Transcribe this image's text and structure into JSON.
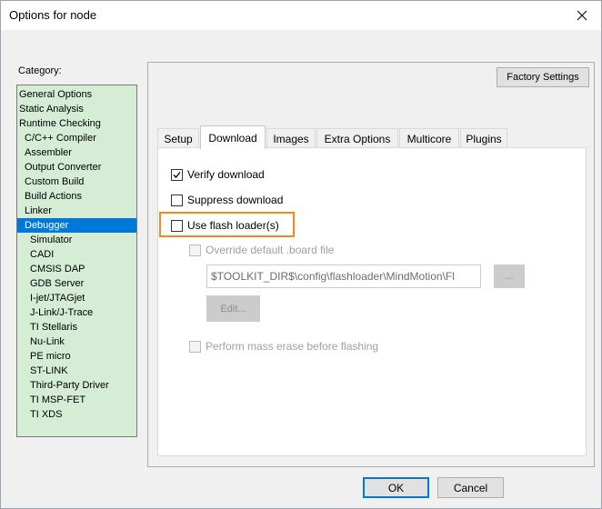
{
  "window": {
    "title": "Options for node"
  },
  "category": {
    "label": "Category:",
    "items": [
      {
        "label": "General Options",
        "level": 0
      },
      {
        "label": "Static Analysis",
        "level": 0
      },
      {
        "label": "Runtime Checking",
        "level": 0
      },
      {
        "label": "C/C++ Compiler",
        "level": 1
      },
      {
        "label": "Assembler",
        "level": 1
      },
      {
        "label": "Output Converter",
        "level": 1
      },
      {
        "label": "Custom Build",
        "level": 1
      },
      {
        "label": "Build Actions",
        "level": 1
      },
      {
        "label": "Linker",
        "level": 1
      },
      {
        "label": "Debugger",
        "level": 1,
        "selected": true
      },
      {
        "label": "Simulator",
        "level": 2
      },
      {
        "label": "CADI",
        "level": 2
      },
      {
        "label": "CMSIS DAP",
        "level": 2
      },
      {
        "label": "GDB Server",
        "level": 2
      },
      {
        "label": "I-jet/JTAGjet",
        "level": 2
      },
      {
        "label": "J-Link/J-Trace",
        "level": 2
      },
      {
        "label": "TI Stellaris",
        "level": 2
      },
      {
        "label": "Nu-Link",
        "level": 2
      },
      {
        "label": "PE micro",
        "level": 2
      },
      {
        "label": "ST-LINK",
        "level": 2
      },
      {
        "label": "Third-Party Driver",
        "level": 2
      },
      {
        "label": "TI MSP-FET",
        "level": 2
      },
      {
        "label": "TI XDS",
        "level": 2
      }
    ]
  },
  "panel": {
    "factory_settings": "Factory Settings",
    "tabs": [
      "Setup",
      "Download",
      "Images",
      "Extra Options",
      "Multicore",
      "Plugins"
    ],
    "active_tab": "Download"
  },
  "download": {
    "verify_download": {
      "label": "Verify download",
      "checked": true
    },
    "suppress_download": {
      "label": "Suppress download",
      "checked": false
    },
    "use_flash_loader": {
      "label": "Use flash loader(s)",
      "checked": false
    },
    "override_board_file": {
      "label": "Override default .board file",
      "checked": false,
      "disabled": true
    },
    "board_file_path": "$TOOLKIT_DIR$\\config\\flashloader\\MindMotion\\Fl",
    "browse_label": "...",
    "edit_label": "Edit...",
    "mass_erase": {
      "label": "Perform mass erase before flashing",
      "checked": false,
      "disabled": true
    }
  },
  "buttons": {
    "ok": "OK",
    "cancel": "Cancel"
  },
  "colors": {
    "category_bg": "#d5ecd5",
    "selection": "#0078d7",
    "highlight": "#f08a1a"
  }
}
